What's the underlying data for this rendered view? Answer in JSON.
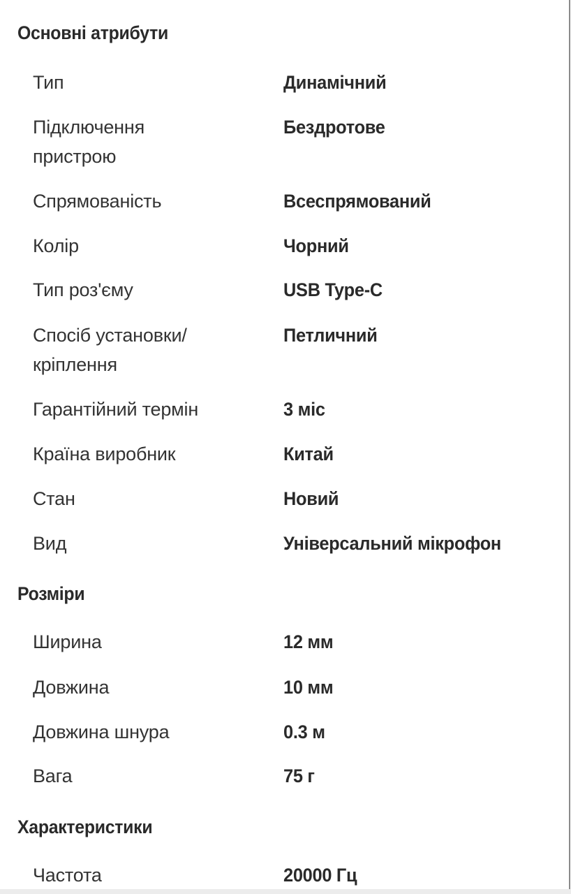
{
  "sections": [
    {
      "title": "Основні атрибути",
      "rows": [
        {
          "label": "Тип",
          "value": "Динамічний"
        },
        {
          "label": "Підключення пристрою",
          "value": "Бездротове"
        },
        {
          "label": "Спрямованість",
          "value": "Всеспрямований"
        },
        {
          "label": "Колір",
          "value": "Чорний"
        },
        {
          "label": "Тип роз'єму",
          "value": "USB Type-C"
        },
        {
          "label": "Спосіб установки/ кріплення",
          "value": "Петличний"
        },
        {
          "label": "Гарантійний термін",
          "value": "3 міс"
        },
        {
          "label": "Країна виробник",
          "value": "Китай"
        },
        {
          "label": "Стан",
          "value": "Новий"
        },
        {
          "label": "Вид",
          "value": "Універсальний мікрофон"
        }
      ]
    },
    {
      "title": "Розміри",
      "rows": [
        {
          "label": "Ширина",
          "value": "12 мм"
        },
        {
          "label": "Довжина",
          "value": "10 мм"
        },
        {
          "label": "Довжина шнура",
          "value": "0.3 м"
        },
        {
          "label": "Вага",
          "value": "75 г"
        }
      ]
    },
    {
      "title": "Характеристики",
      "rows": [
        {
          "label": "Частота",
          "value": "20000 Гц"
        }
      ]
    }
  ]
}
